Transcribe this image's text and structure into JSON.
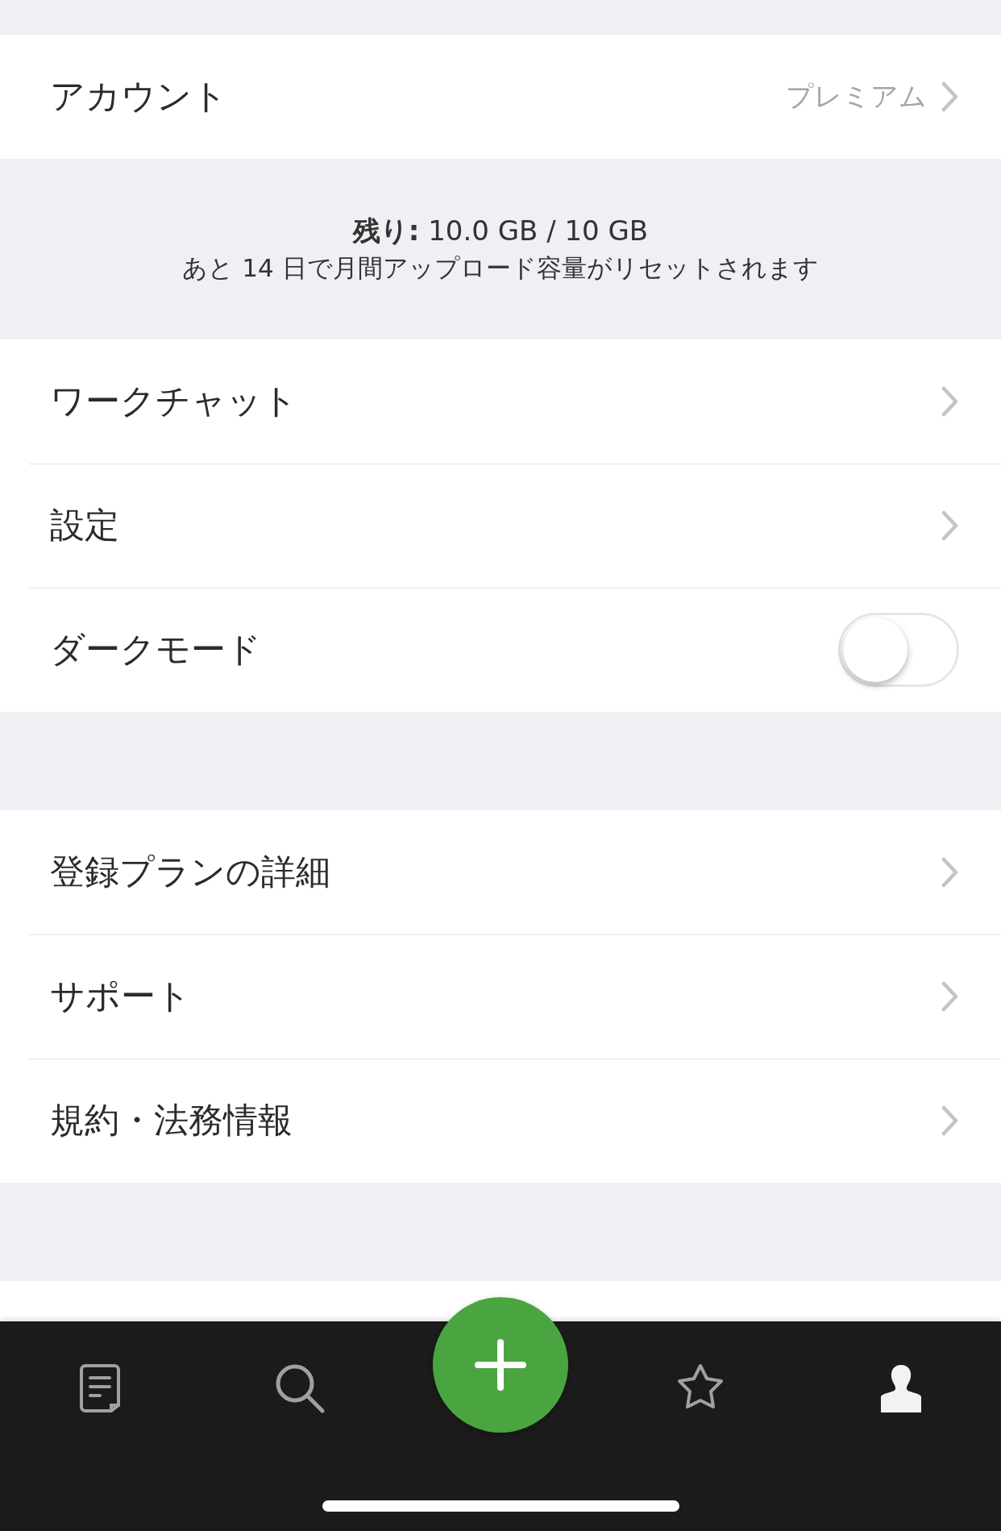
{
  "account": {
    "label": "アカウント",
    "value": "プレミアム"
  },
  "usage": {
    "remaining": "**残り:** 10.0 GB / 10 GB",
    "note": "あと 14 日で月間アップロード容量がリセットされます"
  },
  "sections": [
    {
      "items": [
        {
          "kind": "link",
          "label": "ワークチャット"
        },
        {
          "kind": "link",
          "label": "設定"
        },
        {
          "kind": "toggle",
          "label": "ダークモード",
          "on": false
        }
      ]
    },
    {
      "items": [
        {
          "kind": "link",
          "label": "登録プランの詳細"
        },
        {
          "kind": "link",
          "label": "サポート"
        },
        {
          "kind": "link",
          "label": "規約・法務情報"
        }
      ]
    }
  ],
  "tabs": [
    {
      "kind": "notes",
      "selected": false
    },
    {
      "kind": "search",
      "selected": false
    },
    {
      "kind": "star",
      "selected": false
    },
    {
      "kind": "account",
      "selected": true
    }
  ]
}
